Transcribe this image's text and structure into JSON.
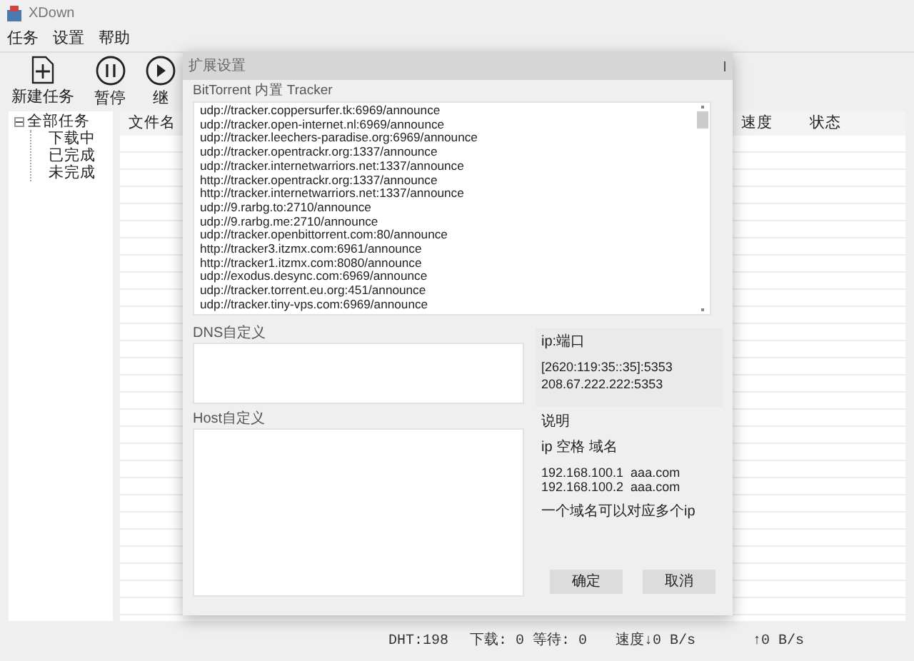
{
  "window": {
    "title": "XDown"
  },
  "menu": [
    "任务",
    "设置",
    "帮助"
  ],
  "toolbar": [
    {
      "label": "新建任务",
      "kind": "new"
    },
    {
      "label": "暂停",
      "kind": "pause"
    },
    {
      "label": "继",
      "kind": "resume"
    }
  ],
  "sidebar": {
    "items": [
      {
        "label": "全部任务",
        "expanded": true,
        "children": [
          {
            "label": "下载中"
          },
          {
            "label": "已完成"
          },
          {
            "label": "未完成"
          }
        ]
      }
    ]
  },
  "table": {
    "columns": [
      "文件名",
      "速度",
      "状态"
    ]
  },
  "status_bar": {
    "dht": "DHT:198",
    "counts": "下载: 0 等待: 0",
    "down_speed": "速度↓0 B/s",
    "up_speed": "↑0 B/s"
  },
  "dialog": {
    "title": "扩展设置",
    "tracker": {
      "label": "BitTorrent 内置 Tracker",
      "lines": [
        "udp://tracker.coppersurfer.tk:6969/announce",
        "udp://tracker.open-internet.nl:6969/announce",
        "udp://tracker.leechers-paradise.org:6969/announce",
        "udp://tracker.opentrackr.org:1337/announce",
        "udp://tracker.internetwarriors.net:1337/announce",
        "http://tracker.opentrackr.org:1337/announce",
        "http://tracker.internetwarriors.net:1337/announce",
        "udp://9.rarbg.to:2710/announce",
        "udp://9.rarbg.me:2710/announce",
        "udp://tracker.openbittorrent.com:80/announce",
        "http://tracker3.itzmx.com:6961/announce",
        "http://tracker1.itzmx.com:8080/announce",
        "udp://exodus.desync.com:6969/announce",
        "udp://tracker.torrent.eu.org:451/announce",
        "udp://tracker.tiny-vps.com:6969/announce"
      ]
    },
    "dns": {
      "label": "DNS自定义",
      "hint_title": "ip:端口",
      "hint_lines": [
        "[2620:119:35::35]:5353",
        "208.67.222.222:5353"
      ]
    },
    "host": {
      "label": "Host自定义",
      "hint_title": "说明",
      "hint_format": "ip 空格 域名",
      "hint_lines": [
        "192.168.100.1  aaa.com",
        "192.168.100.2  aaa.com"
      ],
      "hint_note": "一个域名可以对应多个ip"
    },
    "buttons": [
      "确定",
      "取消"
    ]
  }
}
